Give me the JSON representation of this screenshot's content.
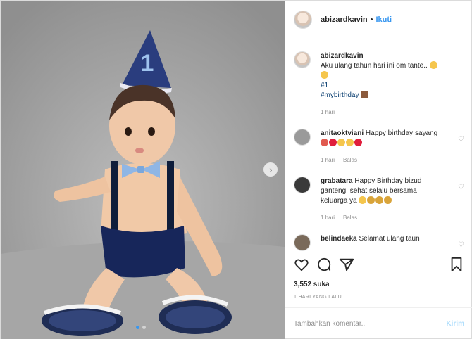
{
  "post": {
    "username": "abizardkavin",
    "separator": "•",
    "follow_label": "Ikuti",
    "hat_number": "1"
  },
  "caption": {
    "username": "abizardkavin",
    "text": "Aku ulang tahun hari ini om tante..",
    "line2": "#1",
    "line3": "#mybirthday",
    "age": "1 hari"
  },
  "comments": [
    {
      "username": "anitaoktviani",
      "text": "Happy birthday sayang",
      "age": "1 hari",
      "reply": "Balas"
    },
    {
      "username": "grabatara",
      "text": "Happy Birthday bizud ganteng, sehat selalu bersama keluarga ya",
      "age": "1 hari",
      "reply": "Balas"
    },
    {
      "username": "belindaeka",
      "text": "Selamat ulang taun"
    }
  ],
  "likes": "3,552 suka",
  "timestamp": "1 HARI YANG LALU",
  "comment_box": {
    "placeholder": "Tambahkan komentar...",
    "send_label": "Kirim"
  },
  "icons": [
    "heart-icon",
    "comment-icon",
    "share-icon",
    "bookmark-icon",
    "chevron-right-icon"
  ],
  "colors": {
    "accent": "#3897f0",
    "text": "#262626",
    "muted": "#8e8e8e"
  }
}
